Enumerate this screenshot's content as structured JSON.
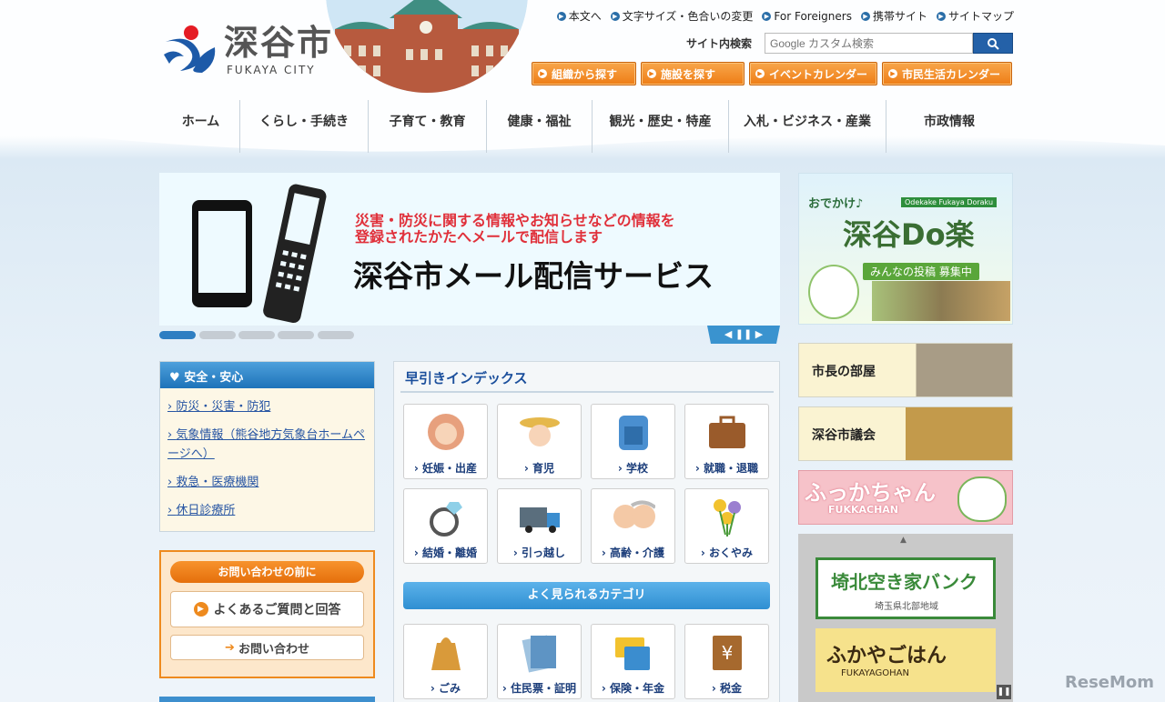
{
  "header": {
    "logo_jp": "深谷市",
    "logo_en": "FUKAYA CITY",
    "util_links": [
      "本文へ",
      "文字サイズ・色合いの変更",
      "For Foreigners",
      "携帯サイト",
      "サイトマップ"
    ],
    "search_label": "サイト内検索",
    "search_placeholder": "Google カスタム検索",
    "quick_buttons": [
      "組織から探す",
      "施設を探す",
      "イベントカレンダー",
      "市民生活カレンダー"
    ]
  },
  "nav": [
    "ホーム",
    "くらし・手続き",
    "子育て・教育",
    "健康・福祉",
    "観光・歴史・特産",
    "入札・ビジネス・産業",
    "市政情報"
  ],
  "hero": {
    "line1": "災害・防災に関する情報やお知らせなどの情報を",
    "line2": "登録されたかたへメールで配信します",
    "title": "深谷市メール配信サービス",
    "pager_count": 5,
    "pager_active": 1,
    "controls": "◀ ❚❚ ▶"
  },
  "safety": {
    "title": "安全・安心",
    "links": [
      "防災・災害・防犯",
      "気象情報（熊谷地方気象台ホームページへ）",
      "救急・医療機関",
      "休日診療所"
    ]
  },
  "inquiry": {
    "head": "お問い合わせの前に",
    "faq": "よくあるご質問と回答",
    "contact": "お問い合わせ"
  },
  "index": {
    "title": "早引きインデックス",
    "tiles": [
      "妊娠・出産",
      "育児",
      "学校",
      "就職・退職",
      "結婚・離婚",
      "引っ越し",
      "高齢・介護",
      "おくやみ"
    ],
    "category_title": "よく見られるカテゴリ",
    "cat_tiles": [
      "ごみ",
      "住民票・証明",
      "保険・年金",
      "税金"
    ]
  },
  "right": {
    "odekake_top": "おでかけ♪",
    "odekake_sub": "Odekake Fukaya Doraku",
    "odekake_title": "深谷Do楽",
    "odekake_badge": "みんなの投稿 募集中",
    "mayor": "市長の部屋",
    "council": "深谷市議会",
    "fukkachan": "ふっかちゃん",
    "fukkachan_en": "FUKKACHAN",
    "akiya": "埼北空き家バンク",
    "akiya_sub": "埼玉県北部地域",
    "gohan": "ふかやごはん",
    "gohan_en": "FUKAYAGOHAN"
  },
  "watermark": "ReseMom"
}
